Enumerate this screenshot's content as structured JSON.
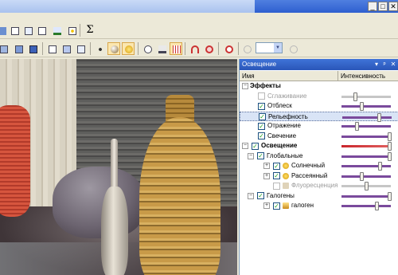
{
  "window": {
    "min_glyph": "_",
    "max_glyph": "□",
    "close_glyph": "✕"
  },
  "toolbar": {
    "sigma_label": "Σ",
    "zoom_value": ""
  },
  "panel": {
    "title": "Освещение",
    "pin_glyph": "▾",
    "float_glyph": "ᵖ",
    "close_glyph": "✕",
    "col_name": "Имя",
    "col_intensity": "Интенсивность",
    "rows": [
      {
        "label": "Эффекты",
        "kind": "group",
        "expander": "−",
        "intensity": null
      },
      {
        "label": "Сглаживание",
        "kind": "item",
        "checked": false,
        "disabled": true,
        "intensity": 0.25
      },
      {
        "label": "Отблеск",
        "kind": "item",
        "checked": true,
        "intensity": 0.4
      },
      {
        "label": "Рельефность",
        "kind": "item",
        "checked": true,
        "selected": true,
        "intensity": 0.75
      },
      {
        "label": "Отражение",
        "kind": "item",
        "checked": true,
        "intensity": 0.3
      },
      {
        "label": "Свечение",
        "kind": "item",
        "checked": true,
        "intensity": 1.0
      },
      {
        "label": "Освещение",
        "kind": "group",
        "expander": "−",
        "checked": true,
        "intensity": 1.0
      },
      {
        "label": "Глобальные",
        "kind": "subgroup",
        "expander": "−",
        "checked": true,
        "intensity": 1.0
      },
      {
        "label": "Солнечный",
        "kind": "light",
        "expander": "+",
        "checked": true,
        "intensity": 0.8
      },
      {
        "label": "Рассеянный",
        "kind": "light",
        "expander": "+",
        "checked": true,
        "intensity": 0.4
      },
      {
        "label": "Флуоресценция",
        "kind": "light",
        "checked": false,
        "disabled": true,
        "intensity": 0.5
      },
      {
        "label": "Галогены",
        "kind": "subgroup",
        "expander": "−",
        "checked": true,
        "intensity": 1.0
      },
      {
        "label": "галоген",
        "kind": "lamp",
        "expander": "+",
        "checked": true,
        "intensity": 0.72
      }
    ]
  }
}
